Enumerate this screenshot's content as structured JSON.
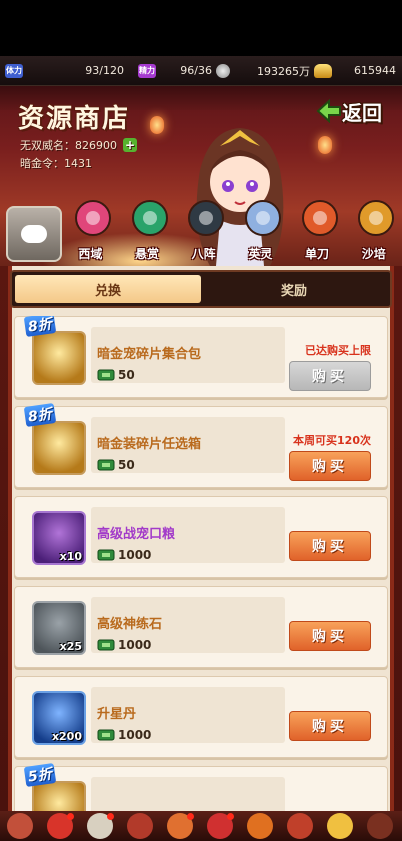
{
  "resources": [
    {
      "icon": "stamina-icon",
      "badge": "体力",
      "value": "93/120"
    },
    {
      "icon": "energy-icon",
      "badge": "精力",
      "value": "96/36"
    },
    {
      "icon": "silver-coin-icon",
      "badge": "",
      "value": "193265万"
    },
    {
      "icon": "gold-ingot-icon",
      "badge": "",
      "value": "615944"
    }
  ],
  "header": {
    "title": "资源商店",
    "back_label": "返回",
    "fame_label": "无双威名：",
    "fame_value": "826900",
    "token_label": "暗金令：",
    "token_value": "1431"
  },
  "categories": [
    {
      "label": "西域",
      "icon": "western-region-icon",
      "color": "#e0467a"
    },
    {
      "label": "悬赏",
      "icon": "bounty-icon",
      "color": "#2aa36a"
    },
    {
      "label": "八阵",
      "icon": "formation-icon",
      "color": "#2f3a44"
    },
    {
      "label": "英灵",
      "icon": "heroic-spirit-icon",
      "color": "#8fb0e0"
    },
    {
      "label": "单刀",
      "icon": "single-blade-icon",
      "color": "#e05a2a"
    },
    {
      "label": "沙培",
      "icon": "sand-icon",
      "color": "#e09a2a"
    }
  ],
  "tabs": [
    {
      "label": "兑换",
      "active": true
    },
    {
      "label": "奖励",
      "active": false
    }
  ],
  "items": [
    {
      "discount": "8折",
      "name": "暗金宠碎片集合包",
      "name_color": "orange",
      "price": "50",
      "note": "已达购买上限",
      "buy_label": "购买",
      "disabled": true,
      "thumb": "gold",
      "qty": ""
    },
    {
      "discount": "8折",
      "name": "暗金装碎片任选箱",
      "name_color": "orange",
      "price": "50",
      "note": "本周可买120次",
      "buy_label": "购买",
      "disabled": false,
      "thumb": "gold",
      "qty": ""
    },
    {
      "discount": "",
      "name": "高级战宠口粮",
      "name_color": "purple",
      "price": "1000",
      "note": "",
      "buy_label": "购买",
      "disabled": false,
      "thumb": "purple",
      "qty": "x10"
    },
    {
      "discount": "",
      "name": "高级神练石",
      "name_color": "orange",
      "price": "1000",
      "note": "",
      "buy_label": "购买",
      "disabled": false,
      "thumb": "gray",
      "qty": "x25"
    },
    {
      "discount": "",
      "name": "升星丹",
      "name_color": "orange",
      "price": "1000",
      "note": "",
      "buy_label": "购买",
      "disabled": false,
      "thumb": "blue",
      "qty": "x200"
    },
    {
      "discount": "5折",
      "name": "",
      "name_color": "orange",
      "price": "",
      "note": "",
      "buy_label": "",
      "disabled": false,
      "thumb": "gold",
      "qty": ""
    }
  ],
  "colors": {
    "accent_orange": "#e0622a",
    "limit_red": "#d8321c",
    "panel": "#faf3e8"
  }
}
